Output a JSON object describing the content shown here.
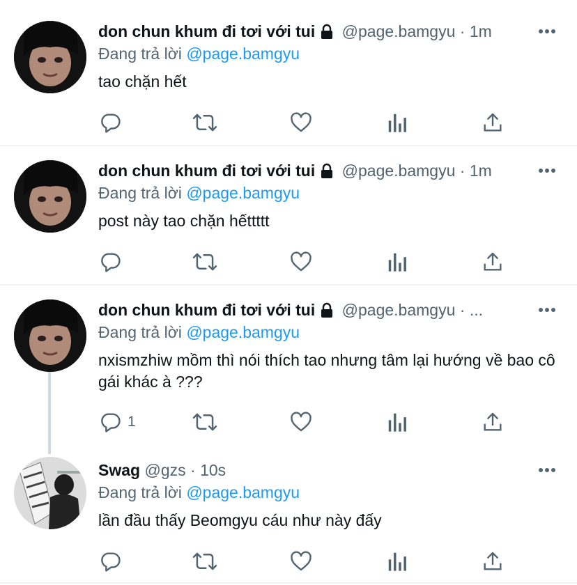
{
  "tweets": [
    {
      "name": "don chun khum đi tơi với tui",
      "handle": "@page.bamgyu",
      "dot": "·",
      "time": "1m",
      "reply_prefix": "Đang trả lời ",
      "reply_to": "@page.bamgyu",
      "text": "tao chặn hết",
      "reply_count": ""
    },
    {
      "name": "don chun khum đi tơi với tui",
      "handle": "@page.bamgyu",
      "dot": "·",
      "time": "1m",
      "reply_prefix": "Đang trả lời ",
      "reply_to": "@page.bamgyu",
      "text": "post này tao chặn hếttttt",
      "reply_count": ""
    },
    {
      "name": "don chun khum đi tơi với tui",
      "handle": "@page.bamgyu",
      "dot": "·",
      "time": "...",
      "reply_prefix": "Đang trả lời ",
      "reply_to": "@page.bamgyu",
      "text": "nxismzhiw mồm thì nói thích tao nhưng tâm lại hướng về bao cô gái khác à ???",
      "reply_count": "1"
    },
    {
      "name": "Swag",
      "handle": "@gzs",
      "dot": "·",
      "time": "10s",
      "reply_prefix": "Đang trả lời ",
      "reply_to": "@page.bamgyu",
      "text": "lần đầu thấy Beomgyu cáu như này đấy",
      "reply_count": ""
    }
  ],
  "icons": {
    "reply": "reply-icon",
    "retweet": "retweet-icon",
    "like": "heart-icon",
    "analytics": "analytics-icon",
    "share": "share-icon",
    "more": "more-icon",
    "lock": "lock-icon"
  },
  "colors": {
    "mention": "#1d9bf0",
    "secondary": "#536471",
    "primary": "#0f1419",
    "divider": "#eff3f4",
    "thread_line": "#cfd9de"
  }
}
